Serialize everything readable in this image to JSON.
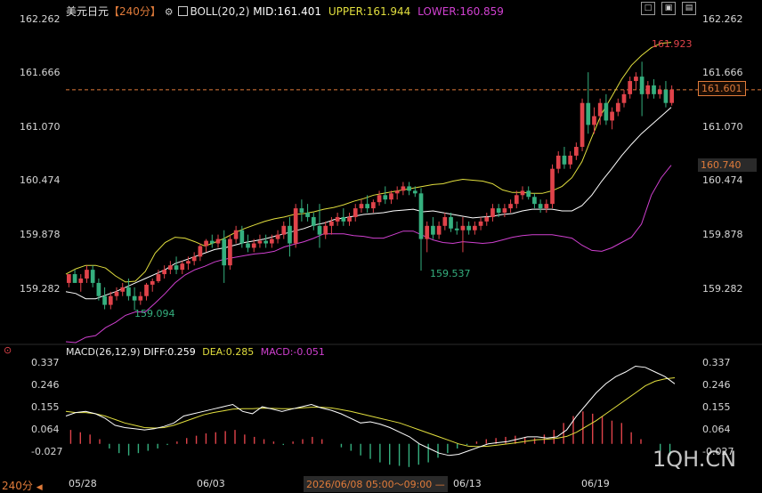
{
  "header": {
    "symbol": "美元日元",
    "period": "【240分】",
    "settings_glyph": "⚙",
    "boll_label": "BOLL(20,2)",
    "mid_label": "MID:161.401",
    "upper_label": "UPPER:161.944",
    "lower_label": "LOWER:160.859"
  },
  "macd_header": {
    "label": "MACD(26,12,9)",
    "diff_label": "DIFF:0.259",
    "dea_label": "DEA:0.285",
    "macd_label": "MACD:-0.051"
  },
  "window_buttons": [
    "□",
    "▣",
    "▤"
  ],
  "footer": {
    "period_button": "240分",
    "dates": [
      "05/28",
      "06/03",
      "06/13",
      "06/19"
    ],
    "crosshair_time": "2026/06/08 05:00～09:00 —"
  },
  "watermark": "1QH.CN",
  "colors": {
    "up": "#e0434a",
    "down": "#35b07f",
    "upper": "#e2df3e",
    "mid": "#ffffff",
    "lower": "#d040d0",
    "diff": "#ffffff",
    "dea": "#e2df3e",
    "current_line": "#e07b3a"
  },
  "chart_data": {
    "type": "candlestick",
    "price_axis": {
      "ticks": [
        "162.262",
        "161.666",
        "161.070",
        "160.474",
        "159.878",
        "159.282"
      ],
      "ylim": [
        158.72,
        162.4
      ]
    },
    "macd_axis": {
      "ticks": [
        "0.337",
        "0.246",
        "0.155",
        "0.064",
        "-0.027"
      ],
      "ylim": [
        -0.12,
        0.36
      ]
    },
    "boll_current": {
      "mid": 161.401,
      "upper": 161.944,
      "lower": 160.859
    },
    "current_price": "161.601",
    "lower_marker": "160.740",
    "annotations": {
      "high": "161.923",
      "low1": "159.094",
      "low2": "159.537"
    },
    "candles": [
      [
        159.4,
        159.5,
        159.35,
        159.5
      ],
      [
        159.5,
        159.55,
        159.4,
        159.4
      ],
      [
        159.4,
        159.5,
        159.3,
        159.45
      ],
      [
        159.45,
        159.6,
        159.4,
        159.55
      ],
      [
        159.55,
        159.6,
        159.35,
        159.4
      ],
      [
        159.4,
        159.45,
        159.2,
        159.25
      ],
      [
        159.25,
        159.35,
        159.1,
        159.15
      ],
      [
        159.15,
        159.3,
        159.1,
        159.25
      ],
      [
        159.25,
        159.35,
        159.2,
        159.3
      ],
      [
        159.3,
        159.4,
        159.25,
        159.35
      ],
      [
        159.35,
        159.45,
        159.2,
        159.25
      ],
      [
        159.25,
        159.35,
        159.09,
        159.2
      ],
      [
        159.2,
        159.3,
        159.15,
        159.25
      ],
      [
        159.25,
        159.4,
        159.2,
        159.38
      ],
      [
        159.38,
        159.45,
        159.3,
        159.42
      ],
      [
        159.42,
        159.55,
        159.4,
        159.5
      ],
      [
        159.5,
        159.6,
        159.45,
        159.55
      ],
      [
        159.55,
        159.65,
        159.5,
        159.6
      ],
      [
        159.6,
        159.7,
        159.5,
        159.55
      ],
      [
        159.55,
        159.65,
        159.5,
        159.62
      ],
      [
        159.62,
        159.7,
        159.55,
        159.65
      ],
      [
        159.65,
        159.75,
        159.6,
        159.7
      ],
      [
        159.7,
        159.85,
        159.65,
        159.82
      ],
      [
        159.82,
        159.9,
        159.75,
        159.88
      ],
      [
        159.88,
        159.95,
        159.8,
        159.85
      ],
      [
        159.85,
        159.95,
        159.8,
        159.9
      ],
      [
        159.9,
        160.0,
        159.4,
        159.6
      ],
      [
        159.6,
        159.95,
        159.55,
        159.9
      ],
      [
        159.9,
        160.05,
        159.85,
        160.0
      ],
      [
        160.0,
        160.05,
        159.8,
        159.85
      ],
      [
        159.85,
        159.95,
        159.75,
        159.8
      ],
      [
        159.8,
        159.9,
        159.75,
        159.85
      ],
      [
        159.85,
        159.95,
        159.8,
        159.88
      ],
      [
        159.88,
        159.95,
        159.8,
        159.85
      ],
      [
        159.85,
        159.95,
        159.8,
        159.9
      ],
      [
        159.9,
        160.0,
        159.85,
        159.95
      ],
      [
        159.95,
        160.1,
        159.9,
        160.05
      ],
      [
        160.05,
        160.15,
        159.7,
        159.85
      ],
      [
        159.85,
        160.3,
        159.8,
        160.25
      ],
      [
        160.25,
        160.35,
        160.1,
        160.2
      ],
      [
        160.2,
        160.3,
        160.1,
        160.15
      ],
      [
        160.15,
        160.2,
        160.0,
        160.05
      ],
      [
        160.05,
        160.3,
        159.8,
        159.95
      ],
      [
        159.95,
        160.1,
        159.9,
        160.05
      ],
      [
        160.05,
        160.15,
        159.95,
        160.1
      ],
      [
        160.1,
        160.2,
        160.05,
        160.15
      ],
      [
        160.15,
        160.25,
        160.05,
        160.1
      ],
      [
        160.1,
        160.2,
        160.05,
        160.15
      ],
      [
        160.15,
        160.3,
        160.1,
        160.25
      ],
      [
        160.25,
        160.35,
        160.2,
        160.3
      ],
      [
        160.3,
        160.4,
        160.2,
        160.25
      ],
      [
        160.25,
        160.35,
        160.2,
        160.32
      ],
      [
        160.32,
        160.45,
        160.28,
        160.4
      ],
      [
        160.4,
        160.5,
        160.3,
        160.35
      ],
      [
        160.35,
        160.45,
        160.3,
        160.42
      ],
      [
        160.42,
        160.5,
        160.35,
        160.45
      ],
      [
        160.45,
        160.55,
        160.4,
        160.5
      ],
      [
        160.5,
        160.55,
        160.4,
        160.45
      ],
      [
        160.45,
        160.5,
        160.38,
        160.42
      ],
      [
        160.42,
        160.48,
        159.54,
        159.9
      ],
      [
        159.9,
        160.1,
        159.75,
        160.05
      ],
      [
        160.05,
        160.15,
        159.9,
        159.95
      ],
      [
        159.95,
        160.1,
        159.9,
        160.05
      ],
      [
        160.05,
        160.2,
        160.0,
        160.15
      ],
      [
        160.15,
        160.2,
        159.98,
        160.02
      ],
      [
        160.02,
        160.1,
        159.95,
        160.0
      ],
      [
        160.0,
        160.15,
        159.75,
        160.05
      ],
      [
        160.05,
        160.1,
        159.95,
        160.0
      ],
      [
        160.0,
        160.1,
        159.95,
        160.05
      ],
      [
        160.05,
        160.15,
        160.0,
        160.1
      ],
      [
        160.1,
        160.2,
        160.05,
        160.15
      ],
      [
        160.15,
        160.3,
        160.1,
        160.25
      ],
      [
        160.25,
        160.3,
        160.15,
        160.2
      ],
      [
        160.2,
        160.3,
        160.15,
        160.25
      ],
      [
        160.25,
        160.35,
        160.2,
        160.3
      ],
      [
        160.3,
        160.45,
        160.25,
        160.4
      ],
      [
        160.4,
        160.5,
        160.35,
        160.45
      ],
      [
        160.45,
        160.5,
        160.35,
        160.38
      ],
      [
        160.38,
        160.42,
        160.25,
        160.3
      ],
      [
        160.3,
        160.35,
        160.2,
        160.25
      ],
      [
        160.25,
        160.35,
        160.2,
        160.3
      ],
      [
        160.3,
        160.75,
        160.25,
        160.7
      ],
      [
        160.7,
        160.9,
        160.65,
        160.85
      ],
      [
        160.85,
        160.95,
        160.7,
        160.75
      ],
      [
        160.75,
        160.9,
        160.7,
        160.85
      ],
      [
        160.85,
        161.0,
        160.8,
        160.95
      ],
      [
        160.95,
        161.5,
        160.9,
        161.45
      ],
      [
        161.45,
        161.8,
        161.1,
        161.2
      ],
      [
        161.2,
        161.4,
        161.1,
        161.3
      ],
      [
        161.3,
        161.5,
        161.2,
        161.45
      ],
      [
        161.45,
        161.55,
        161.2,
        161.25
      ],
      [
        161.25,
        161.4,
        161.15,
        161.35
      ],
      [
        161.35,
        161.5,
        161.3,
        161.45
      ],
      [
        161.45,
        161.6,
        161.4,
        161.55
      ],
      [
        161.55,
        161.75,
        161.5,
        161.7
      ],
      [
        161.7,
        161.8,
        161.6,
        161.75
      ],
      [
        161.75,
        161.92,
        161.3,
        161.55
      ],
      [
        161.55,
        161.7,
        161.5,
        161.65
      ],
      [
        161.65,
        161.72,
        161.5,
        161.55
      ],
      [
        161.55,
        161.65,
        161.5,
        161.6
      ],
      [
        161.6,
        161.7,
        161.4,
        161.45
      ],
      [
        161.45,
        161.65,
        161.42,
        161.601
      ]
    ],
    "series": [
      {
        "name": "UPPER",
        "x_end": 101,
        "values": [
          159.5,
          159.56,
          159.6,
          159.6,
          159.57,
          159.48,
          159.41,
          159.42,
          159.53,
          159.74,
          159.86,
          159.92,
          159.91,
          159.87,
          159.82,
          159.86,
          159.91,
          159.97,
          160.02,
          160.06,
          160.1,
          160.13,
          160.15,
          160.18,
          160.19,
          160.21,
          160.24,
          160.26,
          160.29,
          160.33,
          160.36,
          160.4,
          160.42,
          160.44,
          160.46,
          160.48,
          160.5,
          160.52,
          160.53,
          160.56,
          160.58,
          160.57,
          160.56,
          160.53,
          160.46,
          160.43,
          160.43,
          160.42,
          160.42,
          160.45,
          160.5,
          160.6,
          160.78,
          161.06,
          161.33,
          161.52,
          161.72,
          161.88,
          161.99,
          162.08,
          162.13,
          162.14
        ]
      },
      {
        "name": "MID",
        "x_end": 101,
        "values": [
          159.3,
          159.28,
          159.22,
          159.22,
          159.26,
          159.3,
          159.35,
          159.4,
          159.45,
          159.5,
          159.55,
          159.62,
          159.66,
          159.7,
          159.74,
          159.78,
          159.8,
          159.83,
          159.86,
          159.88,
          159.9,
          159.93,
          159.96,
          159.99,
          160.02,
          160.06,
          160.08,
          160.12,
          160.14,
          160.16,
          160.18,
          160.19,
          160.2,
          160.22,
          160.23,
          160.24,
          160.21,
          160.22,
          160.2,
          160.18,
          160.16,
          160.14,
          160.15,
          160.16,
          160.18,
          160.19,
          160.22,
          160.24,
          160.24,
          160.24,
          160.22,
          160.22,
          160.28,
          160.4,
          160.56,
          160.7,
          160.85,
          160.98,
          161.1,
          161.2,
          161.3,
          161.4
        ]
      },
      {
        "name": "LOWER",
        "x_end": 101,
        "values": [
          158.73,
          158.72,
          158.78,
          158.8,
          158.89,
          158.95,
          159.03,
          159.07,
          159.07,
          159.17,
          159.28,
          159.4,
          159.49,
          159.55,
          159.59,
          159.64,
          159.67,
          159.69,
          159.71,
          159.73,
          159.74,
          159.76,
          159.81,
          159.84,
          159.87,
          159.91,
          159.96,
          159.96,
          159.96,
          159.94,
          159.93,
          159.91,
          159.91,
          159.95,
          159.99,
          159.99,
          159.94,
          159.89,
          159.86,
          159.85,
          159.87,
          159.86,
          159.85,
          159.86,
          159.89,
          159.92,
          159.94,
          159.95,
          159.95,
          159.95,
          159.93,
          159.91,
          159.83,
          159.77,
          159.76,
          159.8,
          159.86,
          159.92,
          160.07,
          160.4,
          160.6,
          160.74
        ]
      }
    ],
    "macd": {
      "diff": [
        0.12,
        0.135,
        0.14,
        0.13,
        0.11,
        0.08,
        0.07,
        0.065,
        0.06,
        0.065,
        0.075,
        0.09,
        0.12,
        0.13,
        0.14,
        0.15,
        0.16,
        0.17,
        0.14,
        0.13,
        0.16,
        0.15,
        0.14,
        0.15,
        0.16,
        0.17,
        0.155,
        0.145,
        0.13,
        0.11,
        0.09,
        0.095,
        0.085,
        0.07,
        0.05,
        0.03,
        0.0,
        -0.02,
        -0.04,
        -0.05,
        -0.045,
        -0.03,
        -0.015,
        0.0,
        0.005,
        0.01,
        0.02,
        0.03,
        0.03,
        0.025,
        0.03,
        0.06,
        0.12,
        0.17,
        0.22,
        0.26,
        0.29,
        0.31,
        0.335,
        0.33,
        0.31,
        0.29,
        0.259
      ],
      "dea": [
        0.14,
        0.135,
        0.135,
        0.13,
        0.12,
        0.105,
        0.09,
        0.08,
        0.07,
        0.068,
        0.07,
        0.08,
        0.095,
        0.11,
        0.125,
        0.135,
        0.142,
        0.15,
        0.152,
        0.152,
        0.154,
        0.153,
        0.152,
        0.152,
        0.155,
        0.158,
        0.158,
        0.155,
        0.148,
        0.14,
        0.13,
        0.12,
        0.11,
        0.1,
        0.09,
        0.075,
        0.06,
        0.045,
        0.03,
        0.015,
        0.0,
        -0.01,
        -0.012,
        -0.01,
        -0.005,
        0.0,
        0.005,
        0.012,
        0.018,
        0.02,
        0.024,
        0.032,
        0.05,
        0.075,
        0.1,
        0.13,
        0.16,
        0.19,
        0.22,
        0.25,
        0.27,
        0.28,
        0.285
      ],
      "hist": [
        0.06,
        0.05,
        0.04,
        0.02,
        -0.02,
        -0.04,
        -0.05,
        -0.04,
        -0.03,
        -0.02,
        -0.005,
        0.01,
        0.025,
        0.035,
        0.045,
        0.05,
        0.055,
        0.06,
        0.04,
        0.03,
        0.02,
        0.01,
        -0.005,
        0.01,
        0.02,
        0.03,
        0.02,
        0.0,
        -0.015,
        -0.03,
        -0.05,
        -0.065,
        -0.08,
        -0.09,
        -0.095,
        -0.1,
        -0.09,
        -0.08,
        -0.06,
        -0.04,
        -0.02,
        -0.005,
        0.01,
        0.02,
        0.025,
        0.03,
        0.035,
        0.03,
        0.025,
        0.04,
        0.06,
        0.09,
        0.12,
        0.14,
        0.13,
        0.12,
        0.1,
        0.09,
        0.05,
        0.02,
        0.0,
        -0.03,
        -0.051
      ]
    }
  }
}
